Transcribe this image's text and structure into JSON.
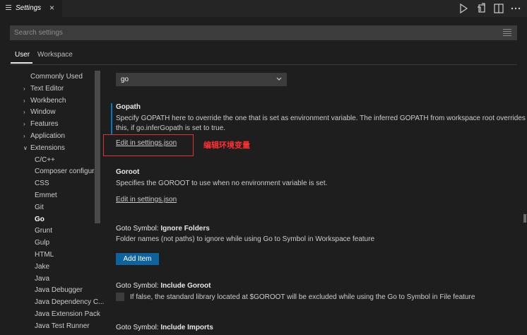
{
  "tab": {
    "title": "Settings",
    "close": "×",
    "icon": "settings-list-icon"
  },
  "actions": [
    {
      "name": "run-icon"
    },
    {
      "name": "open-json-icon"
    },
    {
      "name": "split-editor-icon"
    },
    {
      "name": "more-actions-icon"
    }
  ],
  "search": {
    "placeholder": "Search settings",
    "value": "",
    "filter_icon": "filter-list-icon"
  },
  "scopes": {
    "user": "User",
    "workspace": "Workspace"
  },
  "toc": {
    "items": [
      {
        "label": "Commonly Used",
        "chevron": ""
      },
      {
        "label": "Text Editor",
        "chevron": "›"
      },
      {
        "label": "Workbench",
        "chevron": "›"
      },
      {
        "label": "Window",
        "chevron": "›"
      },
      {
        "label": "Features",
        "chevron": "›"
      },
      {
        "label": "Application",
        "chevron": "›"
      },
      {
        "label": "Extensions",
        "chevron": "∨"
      },
      {
        "label": "C/C++",
        "chevron": ""
      },
      {
        "label": "Composer configur...",
        "chevron": ""
      },
      {
        "label": "CSS",
        "chevron": ""
      },
      {
        "label": "Emmet",
        "chevron": ""
      },
      {
        "label": "Git",
        "chevron": ""
      },
      {
        "label": "Go",
        "chevron": "",
        "active": true
      },
      {
        "label": "Grunt",
        "chevron": ""
      },
      {
        "label": "Gulp",
        "chevron": ""
      },
      {
        "label": "HTML",
        "chevron": ""
      },
      {
        "label": "Jake",
        "chevron": ""
      },
      {
        "label": "Java",
        "chevron": ""
      },
      {
        "label": "Java Debugger",
        "chevron": ""
      },
      {
        "label": "Java Dependency C...",
        "chevron": ""
      },
      {
        "label": "Java Extension Pack",
        "chevron": ""
      },
      {
        "label": "Java Test Runner",
        "chevron": ""
      }
    ]
  },
  "settings": {
    "dropdown_value": "go",
    "gopath": {
      "title": "Gopath",
      "desc_line1": "Specify GOPATH here to override the one that is set as environment variable. The inferred GOPATH from workspace root overrides",
      "desc_line2": "this, if go.inferGopath is set to true.",
      "link": "Edit in settings.json"
    },
    "goroot": {
      "title": "Goroot",
      "desc": "Specifies the GOROOT to use when no environment variable is set.",
      "link": "Edit in settings.json"
    },
    "ignore_folders": {
      "prefix": "Goto Symbol: ",
      "title": "Ignore Folders",
      "desc": "Folder names (not paths) to ignore while using Go to Symbol in Workspace feature",
      "button": "Add Item"
    },
    "include_goroot": {
      "prefix": "Goto Symbol: ",
      "title": "Include Goroot",
      "desc": "If false, the standard library located at $GOROOT will be excluded while using the Go to Symbol in File feature"
    },
    "include_imports": {
      "prefix": "Goto Symbol: ",
      "title": "Include Imports"
    }
  },
  "annotation": "编辑环境变量",
  "colors": {
    "accent": "#007acc",
    "button": "#0e639c",
    "annotation": "#ff3030",
    "background": "#1e1e1e"
  }
}
